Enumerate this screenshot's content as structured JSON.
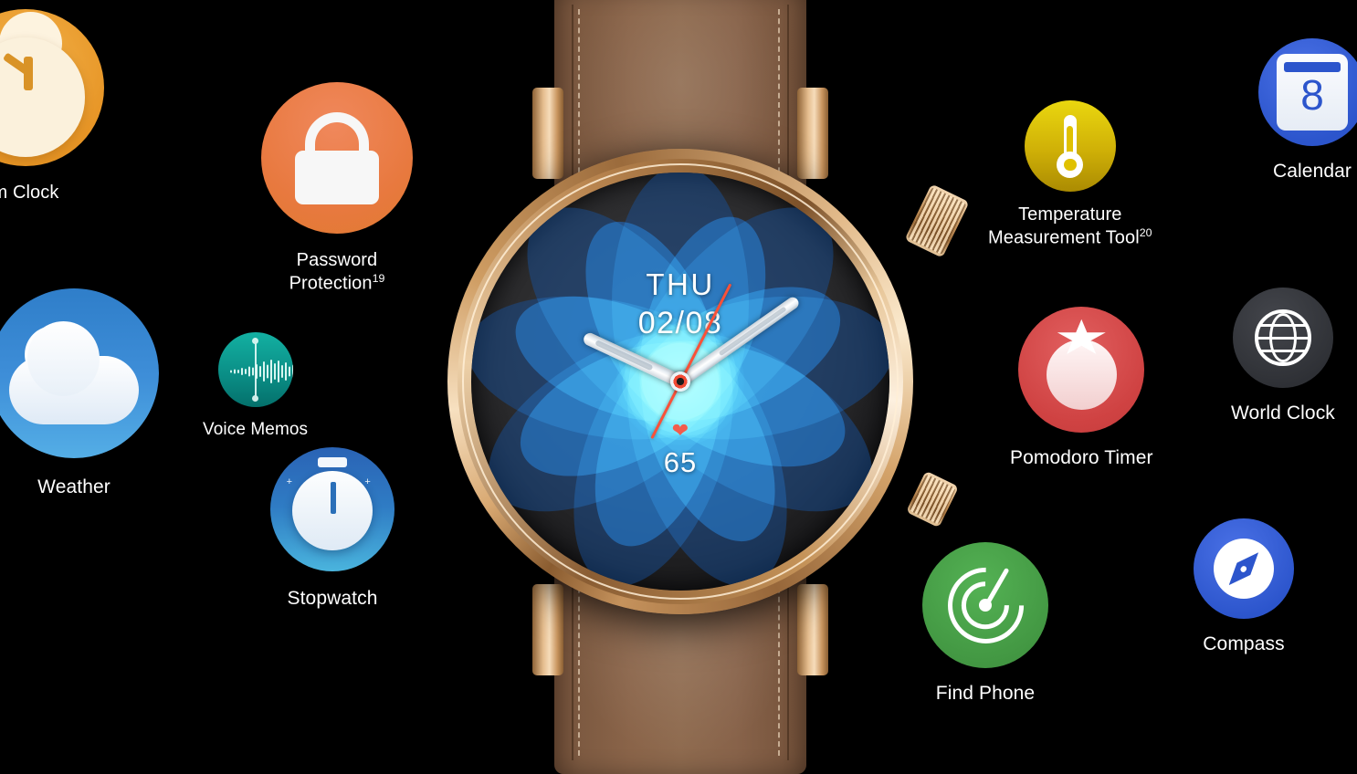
{
  "scene": {
    "background_color": "#000000",
    "product": "smartwatch feature overview"
  },
  "watch": {
    "case_finish": "rose-gold",
    "strap_material": "brown leather with cream stitching",
    "strap_color": "#8a6449",
    "case_color": "#d8a871",
    "screen_color": "#2c2c2e",
    "crowns": [
      {
        "name": "rotating-crown",
        "position": "upper-right"
      },
      {
        "name": "side-button",
        "position": "lower-right"
      }
    ],
    "face": {
      "day": "THU",
      "date": "02/08",
      "heart_rate": "65",
      "heart_icon": "heart-icon",
      "accent_color": "#1f6fd0",
      "second_hand_color": "#fa5138",
      "hour_hand_angle_deg": 295,
      "minute_hand_angle_deg": 55,
      "second_hand_angle_deg": 207
    }
  },
  "apps": [
    {
      "id": "alarm-clock",
      "label": "Alarm Clock",
      "label_visible": "m Clock",
      "icon": "alarm-clock-icon",
      "color": "#efa93c",
      "color_to": "#e79526",
      "clipped": "left-edge"
    },
    {
      "id": "password-protection",
      "label": "Password Protection",
      "label_line1": "Password",
      "label_line2": "Protection",
      "footnote": "19",
      "icon": "lock-icon",
      "color": "#ef7a4e",
      "color_to": "#e8893f"
    },
    {
      "id": "weather",
      "label": "Weather",
      "icon": "moon-cloud-icon",
      "color": "#2f7ec9",
      "color_to": "#4aa3e0"
    },
    {
      "id": "voice-memos",
      "label": "Voice Memos",
      "icon": "waveform-icon",
      "color": "#12a79a",
      "color_to": "#077a73"
    },
    {
      "id": "stopwatch",
      "label": "Stopwatch",
      "icon": "stopwatch-icon",
      "color": "#2a63b5",
      "color_to": "#48b3dc"
    },
    {
      "id": "temperature-measurement-tool",
      "label": "Temperature Measurement Tool",
      "label_line1": "Temperature",
      "label_line2": "Measurement Tool",
      "footnote": "20",
      "icon": "thermometer-icon",
      "color": "#e8ce12",
      "color_to": "#b59204"
    },
    {
      "id": "calendar",
      "label": "Calendar",
      "icon": "calendar-icon",
      "badge_number": "8",
      "color": "#3a62dd",
      "color_to": "#2c55cc",
      "clipped": "right-edge"
    },
    {
      "id": "pomodoro-timer",
      "label": "Pomodoro Timer",
      "icon": "tomato-icon",
      "color": "#dc4b4b",
      "color_to": "#c33c3c"
    },
    {
      "id": "world-clock",
      "label": "World Clock",
      "icon": "globe-icon",
      "color": "#3b3d42",
      "color_to": "#2b2d31"
    },
    {
      "id": "find-phone",
      "label": "Find Phone",
      "icon": "radar-icon",
      "color": "#49a349",
      "color_to": "#3c8c3c"
    },
    {
      "id": "compass",
      "label": "Compass",
      "icon": "compass-icon",
      "color": "#3a62dd",
      "color_to": "#2c55cc"
    }
  ]
}
